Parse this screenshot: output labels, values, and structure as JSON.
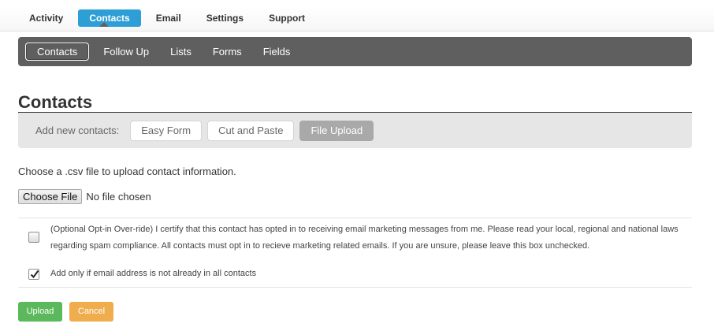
{
  "top_nav": {
    "items": [
      {
        "label": "Activity"
      },
      {
        "label": "Contacts"
      },
      {
        "label": "Email"
      },
      {
        "label": "Settings"
      },
      {
        "label": "Support"
      }
    ],
    "active": "Contacts"
  },
  "sub_nav": {
    "items": [
      {
        "label": "Contacts"
      },
      {
        "label": "Follow Up"
      },
      {
        "label": "Lists"
      },
      {
        "label": "Forms"
      },
      {
        "label": "Fields"
      }
    ],
    "active": "Contacts"
  },
  "page": {
    "title": "Contacts",
    "add_new_label": "Add new contacts:",
    "add_options": [
      {
        "label": "Easy Form"
      },
      {
        "label": "Cut and Paste"
      },
      {
        "label": "File Upload"
      }
    ],
    "active_option": "File Upload",
    "instructions": "Choose a .csv file to upload contact information.",
    "file_button_label": "Choose File",
    "file_status": "No file chosen",
    "optin": {
      "checked": false,
      "text": "(Optional Opt-in Over-ride) I certify that this contact has opted in to receiving email marketing messages from me. Please read your local, regional and national laws regarding spam compliance. All contacts must opt in to recieve marketing related emails. If you are unsure, please leave this box unchecked."
    },
    "dedupe": {
      "checked": true,
      "text": "Add only if email address is not already in all contacts"
    },
    "upload_label": "Upload",
    "cancel_label": "Cancel"
  },
  "colors": {
    "accent": "#2e9fd6",
    "subnav_bg": "#5f5f5f",
    "upload": "#5cb85c",
    "cancel": "#f0ad4e"
  }
}
